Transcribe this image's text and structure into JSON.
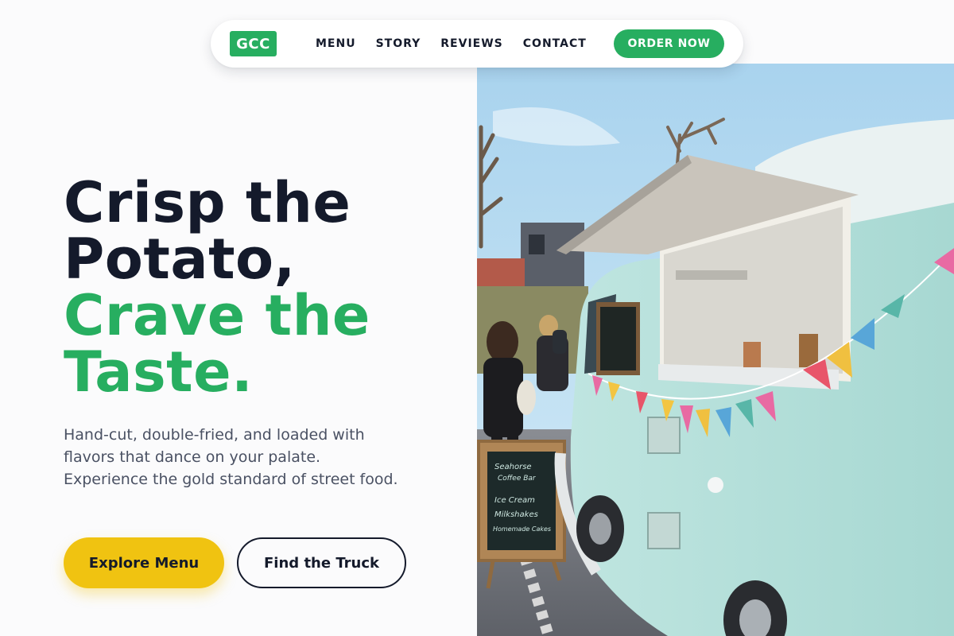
{
  "nav": {
    "logo": "GCC",
    "links": [
      {
        "label": "MENU"
      },
      {
        "label": "STORY"
      },
      {
        "label": "REVIEWS"
      },
      {
        "label": "CONTACT"
      }
    ],
    "cta": "ORDER NOW"
  },
  "hero": {
    "title_lines": [
      "Crisp the",
      "Potato,"
    ],
    "title_accent_lines": [
      "Crave the",
      "Taste."
    ],
    "subtitle": "Hand-cut, double-fried, and loaded with flavors that dance on your palate. Experience the gold standard of street food.",
    "primary_button": "Explore Menu",
    "secondary_button": "Find the Truck"
  },
  "image": {
    "description_icon": "food-truck-photo",
    "chalkboard_lines": [
      "Seahorse",
      "Coffee Bar",
      "Ice Cream",
      "Milkshakes",
      "Homemade Cakes"
    ]
  },
  "colors": {
    "brand_green": "#27ae60",
    "accent_yellow": "#f0c311",
    "dark": "#141a2b",
    "body_text": "#4a5163"
  }
}
